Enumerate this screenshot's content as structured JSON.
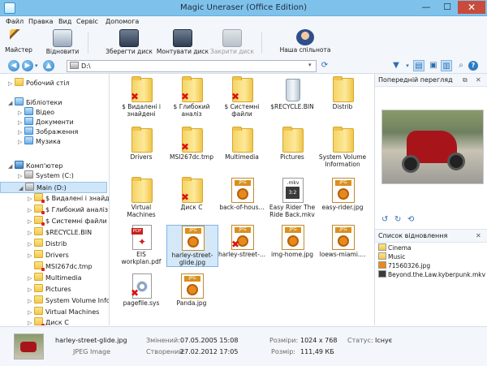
{
  "window": {
    "title": "Magic Uneraser (Office Edition)",
    "min": "—",
    "max": "☐",
    "close": "✕"
  },
  "menu": [
    "Файл",
    "Правка",
    "Вид",
    "Сервіс",
    "Допомога"
  ],
  "toolbar": {
    "wizard": "Майстер",
    "restore": "Відновити",
    "save_disk": "Зберегти диск",
    "mount_disk": "Монтувати диск",
    "close_disk": "Закрити диск",
    "community": "Наша спільнота"
  },
  "address": {
    "path": "D:\\"
  },
  "tree": [
    {
      "label": "Робочий стіл",
      "icon": "folder",
      "level": 0,
      "arrow": "▷"
    },
    {
      "label": "Бібліотеки",
      "icon": "library",
      "level": 0,
      "arrow": "◢"
    },
    {
      "label": "Відео",
      "icon": "library",
      "level": 1,
      "arrow": "▷"
    },
    {
      "label": "Документи",
      "icon": "library",
      "level": 1,
      "arrow": "▷"
    },
    {
      "label": "Зображення",
      "icon": "library",
      "level": 1,
      "arrow": "▷"
    },
    {
      "label": "Музика",
      "icon": "library",
      "level": 1,
      "arrow": "▷"
    },
    {
      "label": "Комп'ютер",
      "icon": "computer",
      "level": 0,
      "arrow": "◢"
    },
    {
      "label": "System (C:)",
      "icon": "drive",
      "level": 1,
      "arrow": "▷"
    },
    {
      "label": "Main (D:)",
      "icon": "drive",
      "level": 1,
      "arrow": "◢",
      "selected": true
    },
    {
      "label": "$ Видалені і знайде",
      "icon": "folder",
      "level": 2,
      "arrow": "▷",
      "deleted": true
    },
    {
      "label": "$ Глибокий аналіз",
      "icon": "folder",
      "level": 2,
      "arrow": "▷",
      "deleted": true
    },
    {
      "label": "$ Системні файли",
      "icon": "folder",
      "level": 2,
      "arrow": "▷",
      "deleted": true
    },
    {
      "label": "$RECYCLE.BIN",
      "icon": "folder",
      "level": 2,
      "arrow": "▷"
    },
    {
      "label": "Distrib",
      "icon": "folder",
      "level": 2,
      "arrow": "▷"
    },
    {
      "label": "Drivers",
      "icon": "folder",
      "level": 2,
      "arrow": "▷"
    },
    {
      "label": "MSI267dc.tmp",
      "icon": "folder",
      "level": 2,
      "arrow": "",
      "deleted": true
    },
    {
      "label": "Multimedia",
      "icon": "folder",
      "level": 2,
      "arrow": "▷"
    },
    {
      "label": "Pictures",
      "icon": "folder",
      "level": 2,
      "arrow": "▷"
    },
    {
      "label": "System Volume Info",
      "icon": "folder",
      "level": 2,
      "arrow": "▷"
    },
    {
      "label": "Virtual Machines",
      "icon": "folder",
      "level": 2,
      "arrow": "▷"
    },
    {
      "label": "Диск С",
      "icon": "folder",
      "level": 2,
      "arrow": "▷",
      "deleted": true
    }
  ],
  "files": [
    {
      "name": "$ Видалені і знайдені",
      "type": "folder",
      "deleted": true
    },
    {
      "name": "$ Глибокий аналіз",
      "type": "folder",
      "deleted": true
    },
    {
      "name": "$ Системні файли",
      "type": "folder",
      "deleted": true
    },
    {
      "name": "$RECYCLE.BIN",
      "type": "bin"
    },
    {
      "name": "Distrib",
      "type": "folder"
    },
    {
      "name": "Drivers",
      "type": "folder"
    },
    {
      "name": "MSI267dc.tmp",
      "type": "folder",
      "deleted": true
    },
    {
      "name": "Multimedia",
      "type": "folder"
    },
    {
      "name": "Pictures",
      "type": "folder"
    },
    {
      "name": "System Volume Information",
      "type": "folder"
    },
    {
      "name": "Virtual Machines",
      "type": "folder"
    },
    {
      "name": "Диск С",
      "type": "folder",
      "deleted": true
    },
    {
      "name": "back-of-hous...",
      "type": "jpg"
    },
    {
      "name": "Easy Rider The Ride Back.mkv",
      "type": "mkv"
    },
    {
      "name": "easy-rider.jpg",
      "type": "jpg"
    },
    {
      "name": "EIS workplan.pdf",
      "type": "pdf"
    },
    {
      "name": "harley-street-glide.jpg",
      "type": "jpg",
      "selected": true
    },
    {
      "name": "harley-street-...",
      "type": "jpg",
      "deleted": true
    },
    {
      "name": "img-home.jpg",
      "type": "jpg"
    },
    {
      "name": "loews-miami....",
      "type": "jpg"
    },
    {
      "name": "pagefile.sys",
      "type": "sys",
      "deleted": true
    },
    {
      "name": "Panda.jpg",
      "type": "jpg"
    }
  ],
  "preview": {
    "title": "Попередній перегляд"
  },
  "recovery": {
    "title": "Список відновлення",
    "items": [
      {
        "label": "Cinema",
        "icon": "folder"
      },
      {
        "label": "Music",
        "icon": "folder"
      },
      {
        "label": "71560326.jpg",
        "icon": "jpg"
      },
      {
        "label": "Beyond.the.Law.kyberpunk.mkv",
        "icon": "mkv"
      }
    ]
  },
  "status": {
    "filename": "harley-street-glide.jpg",
    "filetype": "JPEG Image",
    "modified_label": "Змінений:",
    "modified_value": "07.05.2005 15:08",
    "created_label": "Створений:",
    "created_value": "27.02.2012 17:05",
    "dims_label": "Розміри:",
    "dims_value": "1024 x 768",
    "size_label": "Розмір:",
    "size_value": "111,49 КБ",
    "state_label": "Статус:",
    "state_value": "Існує"
  },
  "colors": {
    "accent": "#7ec2ec",
    "deleted": "#d11111",
    "selection": "#d5e8f8"
  }
}
